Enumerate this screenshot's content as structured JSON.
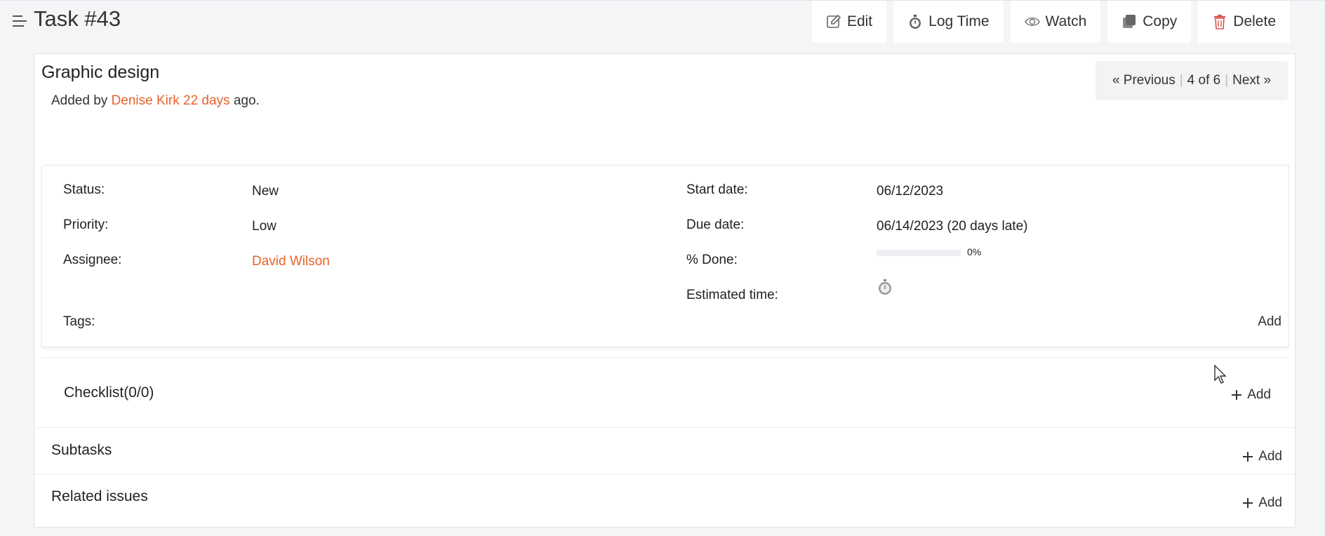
{
  "header": {
    "title": "Task #43",
    "actions": {
      "edit": "Edit",
      "log_time": "Log Time",
      "watch": "Watch",
      "copy": "Copy",
      "delete": "Delete"
    }
  },
  "task": {
    "name": "Graphic design",
    "added_prefix": "Added by",
    "author": "Denise Kirk",
    "age": "22 days",
    "added_suffix": "ago."
  },
  "pager": {
    "previous": "« Previous",
    "position": "4 of 6",
    "next": "Next »",
    "separator": "|"
  },
  "attributes": {
    "status_label": "Status:",
    "status": "New",
    "priority_label": "Priority:",
    "priority": "Low",
    "assignee_label": "Assignee:",
    "assignee": "David Wilson",
    "start_label": "Start date:",
    "start": "06/12/2023",
    "due_label": "Due date:",
    "due": "06/14/2023 (20 days late)",
    "done_label": "% Done:",
    "done_pct": "0%",
    "done_fraction": 0,
    "estimated_label": "Estimated time:",
    "tags_label": "Tags:",
    "tags_add": "Add"
  },
  "sections": {
    "checklist": "Checklist(0/0)",
    "subtasks": "Subtasks",
    "related": "Related issues",
    "add_label": "Add"
  },
  "colors": {
    "accent_link": "#e8622a",
    "delete_icon": "#d9534f"
  }
}
